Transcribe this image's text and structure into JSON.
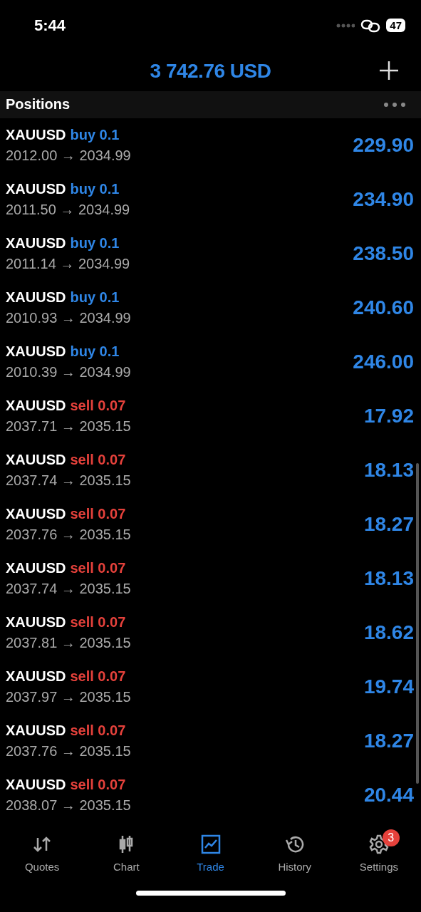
{
  "status_bar": {
    "time": "5:44",
    "battery": "47"
  },
  "header": {
    "balance": "3 742.76 USD"
  },
  "section": {
    "title": "Positions"
  },
  "positions": [
    {
      "symbol": "XAUUSD",
      "kind": "buy",
      "volume": "buy 0.1",
      "prices": "2012.00 → 2034.99",
      "profit": "229.90"
    },
    {
      "symbol": "XAUUSD",
      "kind": "buy",
      "volume": "buy 0.1",
      "prices": "2011.50 → 2034.99",
      "profit": "234.90"
    },
    {
      "symbol": "XAUUSD",
      "kind": "buy",
      "volume": "buy 0.1",
      "prices": "2011.14 → 2034.99",
      "profit": "238.50"
    },
    {
      "symbol": "XAUUSD",
      "kind": "buy",
      "volume": "buy 0.1",
      "prices": "2010.93 → 2034.99",
      "profit": "240.60"
    },
    {
      "symbol": "XAUUSD",
      "kind": "buy",
      "volume": "buy 0.1",
      "prices": "2010.39 → 2034.99",
      "profit": "246.00"
    },
    {
      "symbol": "XAUUSD",
      "kind": "sell",
      "volume": "sell 0.07",
      "prices": "2037.71 → 2035.15",
      "profit": "17.92"
    },
    {
      "symbol": "XAUUSD",
      "kind": "sell",
      "volume": "sell 0.07",
      "prices": "2037.74 → 2035.15",
      "profit": "18.13"
    },
    {
      "symbol": "XAUUSD",
      "kind": "sell",
      "volume": "sell 0.07",
      "prices": "2037.76 → 2035.15",
      "profit": "18.27"
    },
    {
      "symbol": "XAUUSD",
      "kind": "sell",
      "volume": "sell 0.07",
      "prices": "2037.74 → 2035.15",
      "profit": "18.13"
    },
    {
      "symbol": "XAUUSD",
      "kind": "sell",
      "volume": "sell 0.07",
      "prices": "2037.81 → 2035.15",
      "profit": "18.62"
    },
    {
      "symbol": "XAUUSD",
      "kind": "sell",
      "volume": "sell 0.07",
      "prices": "2037.97 → 2035.15",
      "profit": "19.74"
    },
    {
      "symbol": "XAUUSD",
      "kind": "sell",
      "volume": "sell 0.07",
      "prices": "2037.76 → 2035.15",
      "profit": "18.27"
    },
    {
      "symbol": "XAUUSD",
      "kind": "sell",
      "volume": "sell 0.07",
      "prices": "2038.07 → 2035.15",
      "profit": "20.44"
    }
  ],
  "tabs": [
    {
      "label": "Quotes",
      "selected": false
    },
    {
      "label": "Chart",
      "selected": false
    },
    {
      "label": "Trade",
      "selected": true
    },
    {
      "label": "History",
      "selected": false
    },
    {
      "label": "Settings",
      "selected": false,
      "badge": "3"
    }
  ]
}
